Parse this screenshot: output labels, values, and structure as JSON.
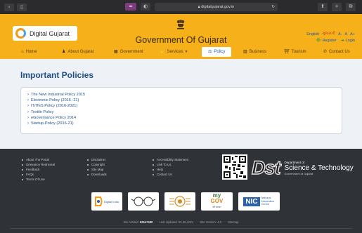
{
  "browser": {
    "url": "digitalgujarat.gov.in",
    "back_icon": "‹",
    "forward_icon": "›",
    "sidebar_icon": "▯",
    "private_icon": "∞",
    "shield_icon": "◐",
    "reload_icon": "↻",
    "share_icon": "⬆",
    "new_tab_icon": "+",
    "tabs_icon": "⧉"
  },
  "header": {
    "logo_text": "Digital Gujarat",
    "site_title": "Government Of Gujarat",
    "lang_english": "English",
    "lang_gujarati": "ગુજરાતી",
    "font_minus": "A-",
    "font_normal": "A",
    "font_plus": "A+",
    "register": "Register",
    "login": "Login",
    "colors": {
      "header_bg": "#f6b01a",
      "title": "#3a2a12",
      "link": "#1b5aa8"
    }
  },
  "nav": {
    "items": [
      {
        "label": "Home",
        "icon": "home-icon",
        "glyph": "⌂"
      },
      {
        "label": "About Gujarat",
        "icon": "person-icon",
        "glyph": "♟"
      },
      {
        "label": "Government",
        "icon": "building-icon",
        "glyph": "▦"
      },
      {
        "label": "Services",
        "icon": "hand-icon",
        "glyph": "✋",
        "caret": "▾"
      },
      {
        "label": "Policy",
        "icon": "policy-icon",
        "glyph": "⚖",
        "active": true
      },
      {
        "label": "Business",
        "icon": "chart-icon",
        "glyph": "▥"
      },
      {
        "label": "Tourism",
        "icon": "tourism-icon",
        "glyph": "⛩"
      },
      {
        "label": "Contact Us",
        "icon": "phone-icon",
        "glyph": "✆"
      }
    ]
  },
  "main": {
    "title": "Important Policies",
    "policies": [
      "The New Industrial Policy 2015",
      "Electronic Policy (2016 -21)",
      "IT/ITeS Policy (2016-2021)",
      "Textile Policy",
      "eGovernance Policy 2014",
      "Startup-Policy (2016-21)"
    ]
  },
  "footer": {
    "col1": [
      "About The Portal",
      "Grievance Redressal",
      "Feedback",
      "FAQs",
      "Terms Of Use"
    ],
    "col2": [
      "Disclaimer",
      "Copyright",
      "Site Map",
      "Downloads"
    ],
    "col3": [
      "Accessibility Statement",
      "Link To Us",
      "Help",
      "Contact Us"
    ],
    "dst": {
      "logo": "Dst",
      "line1": "Department of",
      "line2": "Science & Technology",
      "line3": "Government of Gujarat"
    },
    "partners": {
      "digital_india": "Digital India",
      "mygov_my": "my",
      "mygov_gov": "GOV",
      "mygov_tag": "मेरी सरकार",
      "nic_mark": "NIC",
      "nic_text1": "National",
      "nic_text2": "Informatics",
      "nic_text3": "Centre"
    },
    "visits_label": "Site Visited:",
    "visits_count": "52647480",
    "last_updated": "Last Updated: 02-06-2021",
    "site_version": "Site Version: 4.0",
    "sitemap": "Sitemap"
  }
}
